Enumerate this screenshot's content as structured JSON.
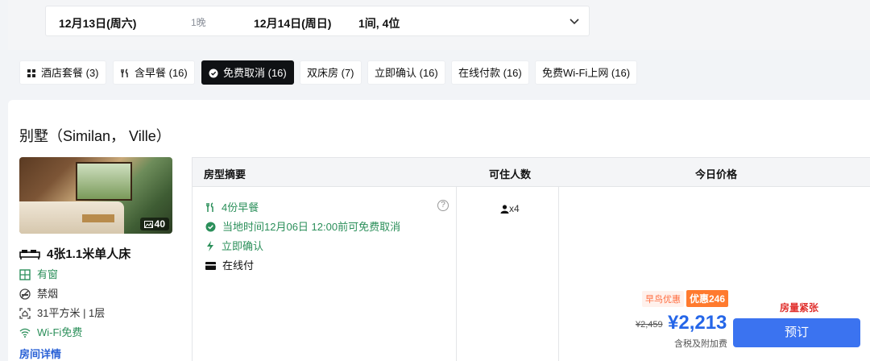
{
  "search": {
    "checkin": "12月13日(周六)",
    "nights": "1晚",
    "checkout": "12月14日(周日)",
    "guests": "1间, 4位"
  },
  "filters": [
    {
      "label": "酒店套餐 (3)",
      "icon": "grid-icon",
      "active": false
    },
    {
      "label": "含早餐 (16)",
      "icon": "utensils-icon",
      "active": false
    },
    {
      "label": "免费取消 (16)",
      "icon": "check-circle-icon",
      "active": true
    },
    {
      "label": "双床房 (7)",
      "icon": "",
      "active": false
    },
    {
      "label": "立即确认 (16)",
      "icon": "",
      "active": false
    },
    {
      "label": "在线付款 (16)",
      "icon": "",
      "active": false
    },
    {
      "label": "免费Wi-Fi上网 (16)",
      "icon": "",
      "active": false
    }
  ],
  "room": {
    "title": "别墅（Similan， Ville）",
    "photo_count": "40",
    "bed": "4张1.1米单人床",
    "features": [
      {
        "label": "有窗",
        "icon": "window-icon",
        "green": true
      },
      {
        "label": "禁烟",
        "icon": "no-smoking-icon",
        "green": false
      },
      {
        "label": "31平方米 | 1层",
        "icon": "area-icon",
        "green": false
      },
      {
        "label": "Wi-Fi免费",
        "icon": "wifi-icon",
        "green": true
      }
    ],
    "details_link": "房间详情"
  },
  "table": {
    "headers": {
      "summary": "房型摘要",
      "capacity": "可住人数",
      "price": "今日价格"
    },
    "perks": [
      {
        "label": "4份早餐",
        "icon": "utensils-icon",
        "green": true
      },
      {
        "label": "当地时间12月06日 12:00前可免费取消",
        "icon": "check-circle-icon",
        "green": true
      },
      {
        "label": "立即确认",
        "icon": "lightning-icon",
        "green": true
      },
      {
        "label": "在线付",
        "icon": "card-icon",
        "green": false
      }
    ],
    "help": "?",
    "capacity": "x4",
    "offer": {
      "early_bird": "早鸟优惠",
      "discount": "优惠246",
      "original": "¥2,459",
      "price": "¥2,213",
      "tax_note": "含税及附加费",
      "scarcity": "房量紧张",
      "book_label": "预订"
    }
  },
  "colors": {
    "accent": "#3b73f0",
    "green": "#2b8f5a",
    "orange": "#ff7a2e",
    "red": "#e0302d"
  }
}
